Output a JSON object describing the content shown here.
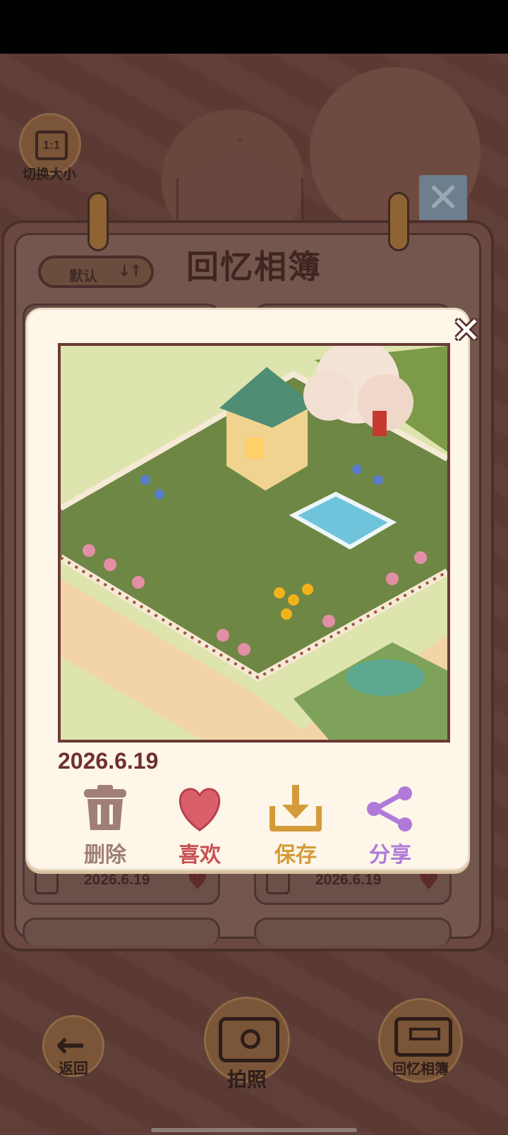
{
  "size_toggle": {
    "icon_text": "1:1",
    "label": "切换大小"
  },
  "album": {
    "title": "回忆相簿",
    "sort_label": "默认",
    "sort_icon": "sort-icon"
  },
  "cards": [
    {
      "date": "2026.6.19"
    },
    {
      "date": "2026.6.19"
    }
  ],
  "dialog": {
    "date": "2026.6.19",
    "actions": [
      {
        "label": "删除",
        "icon": "trash-icon",
        "color": "#a07f79"
      },
      {
        "label": "喜欢",
        "icon": "heart-icon",
        "color": "#c94f55"
      },
      {
        "label": "保存",
        "icon": "download-icon",
        "color": "#d59a3a"
      },
      {
        "label": "分享",
        "icon": "share-icon",
        "color": "#b07ad8"
      }
    ]
  },
  "nav": {
    "back_label": "返回",
    "camera_label": "拍照",
    "album_label": "回忆相簿"
  },
  "colors": {
    "title": "#412521",
    "date": "#6f2f30",
    "dialog_bg": "#fdf6e9"
  }
}
